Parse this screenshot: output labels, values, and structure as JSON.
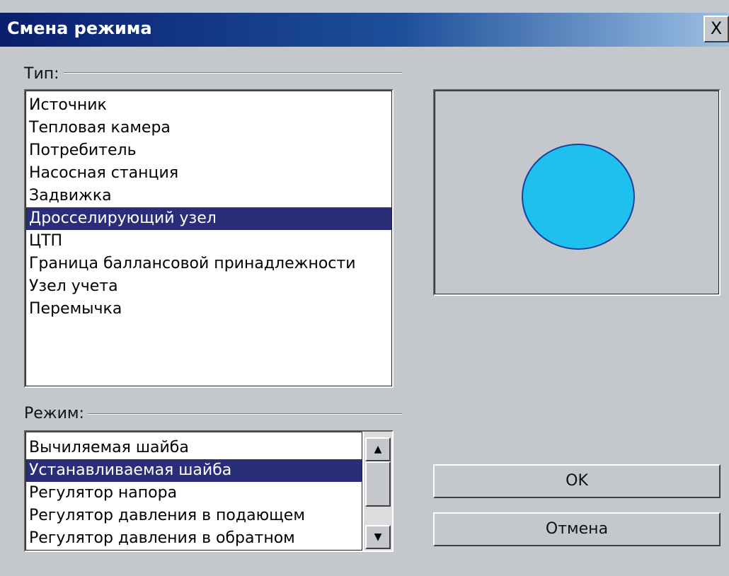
{
  "window": {
    "title": "Смена режима",
    "close_label": "X"
  },
  "type_group": {
    "label": "Тип:",
    "items": [
      "Источник",
      "Тепловая камера",
      "Потребитель",
      "Насосная станция",
      "Задвижка",
      "Дросселирующий узел",
      "ЦТП",
      "Граница баллансовой принадлежности",
      "Узел учета",
      "Перемычка"
    ],
    "selected": "Дросселирующий узел"
  },
  "mode_group": {
    "label": "Режим:",
    "items": [
      "Вычиляемая шайба",
      "Устанавливаемая шайба",
      "Регулятор напора",
      "Регулятор давления в подающем",
      "Регулятор давления в обратном"
    ],
    "selected": "Устанавливаемая шайба"
  },
  "preview": {
    "shape": "circle",
    "fill_color": "#1ec0ee",
    "stroke_color": "#1b3f9a"
  },
  "buttons": {
    "ok_label": "OK",
    "cancel_label": "Отмена"
  },
  "icons": {
    "scroll_up": "▲",
    "scroll_down": "▼"
  },
  "colors": {
    "selection": "#2a2e78",
    "dialog_bg": "#c4c8cc"
  }
}
